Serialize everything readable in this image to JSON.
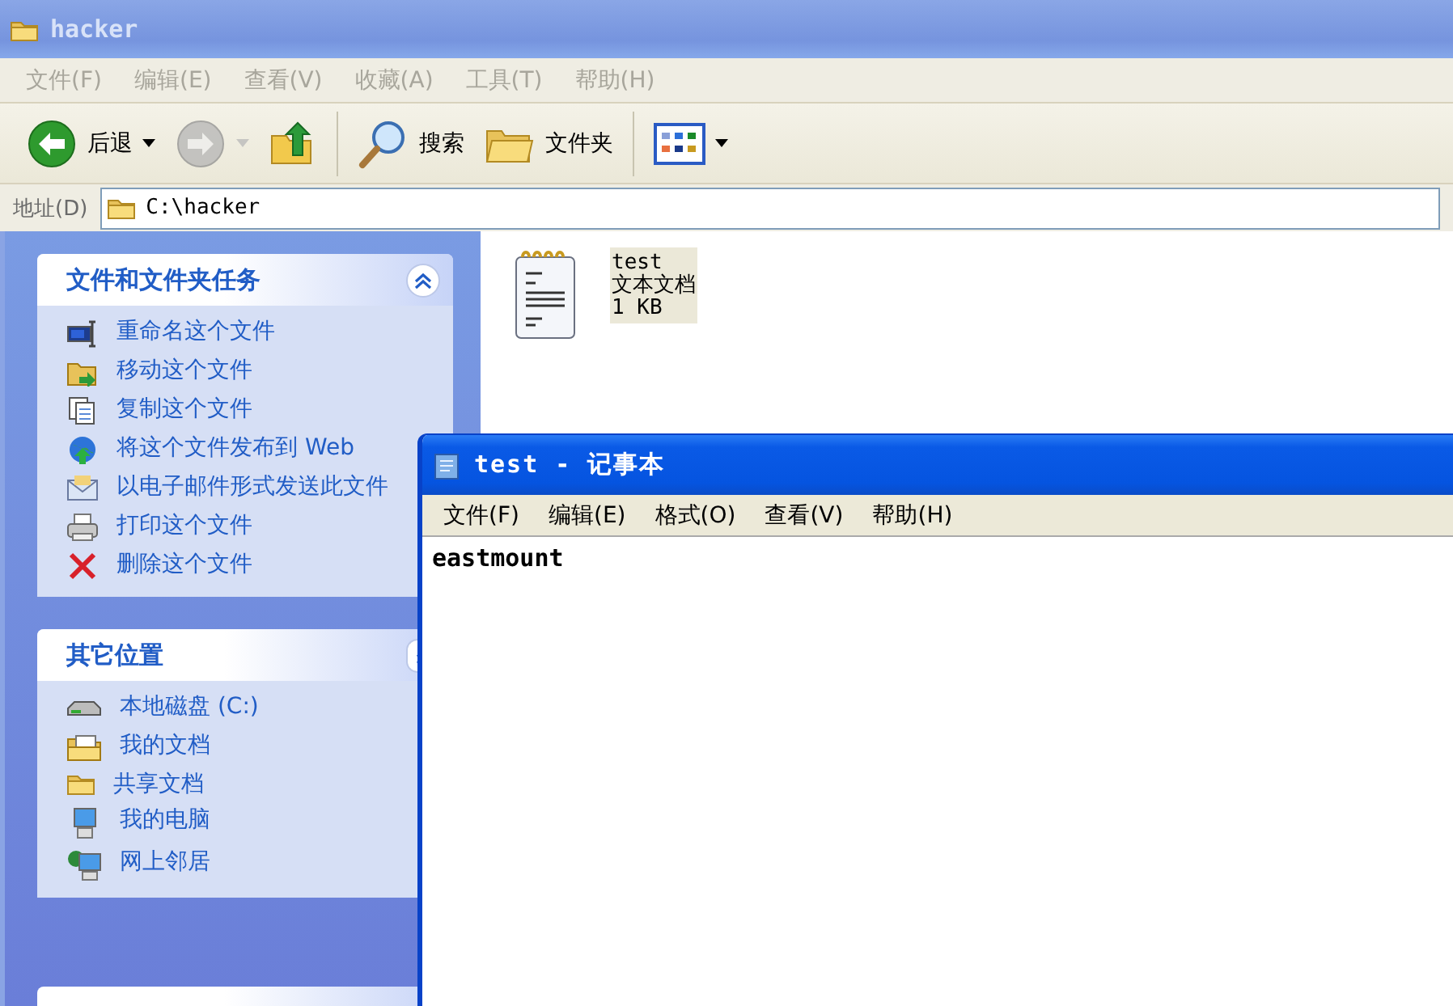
{
  "explorer": {
    "title": "hacker",
    "active": false,
    "menu": [
      "文件(F)",
      "编辑(E)",
      "查看(V)",
      "收藏(A)",
      "工具(T)",
      "帮助(H)"
    ],
    "toolbar": [
      {
        "kind": "back",
        "label": "后退",
        "disabled": false
      },
      {
        "kind": "forward",
        "disabled": true
      },
      {
        "kind": "up",
        "disabled": false
      },
      {
        "kind": "search",
        "label": "搜索",
        "disabled": false
      },
      {
        "kind": "folders",
        "label": "文件夹",
        "disabled": false
      },
      {
        "kind": "views",
        "disabled": false
      }
    ],
    "address": {
      "label": "地址(D)",
      "value": "C:\\hacker"
    },
    "panels": [
      {
        "title": "文件和文件夹任务",
        "expanded": true,
        "items": [
          "重命名这个文件",
          "移动这个文件",
          "复制这个文件",
          "将这个文件发布到 Web",
          "以电子邮件形式发送此文件",
          "打印这个文件",
          "删除这个文件"
        ]
      },
      {
        "title": "其它位置",
        "expanded": true,
        "items": [
          "本地磁盘 (C:)",
          "我的文档",
          "共享文档",
          "我的电脑",
          "网上邻居"
        ]
      }
    ],
    "files": [
      {
        "name": "test",
        "type": "文本文档",
        "size": "1 KB",
        "selected": true
      }
    ]
  },
  "notepad": {
    "title": "test - 记事本",
    "active": true,
    "menu": [
      "文件(F)",
      "编辑(E)",
      "格式(O)",
      "查看(V)",
      "帮助(H)"
    ],
    "text": "eastmount"
  }
}
